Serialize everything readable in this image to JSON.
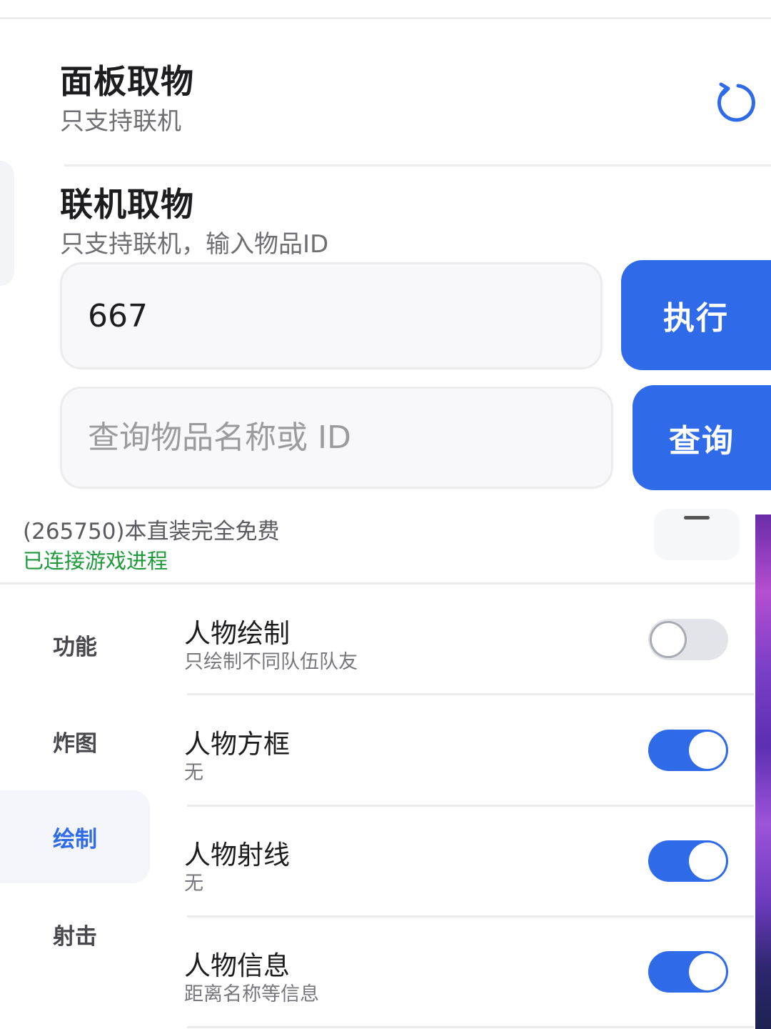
{
  "top_panel": {
    "rows": [
      {
        "title": "面板取物",
        "subtitle": "只支持联机"
      },
      {
        "title": "联机取物",
        "subtitle": "只支持联机，输入物品ID"
      }
    ],
    "item_id_input": {
      "value": "667",
      "placeholder": ""
    },
    "execute_button": "执行",
    "search_input": {
      "value": "",
      "placeholder": "查询物品名称或 ID"
    },
    "search_button": "查询",
    "refresh_icon": "refresh-icon"
  },
  "panel": {
    "info": "(265750)本直装完全免费",
    "status": "已连接游戏进程",
    "status_color": "#1e9a3b",
    "accent_color": "#2f6ae9",
    "minimize_icon": "minus-icon",
    "sidebar": [
      {
        "label": "功能",
        "active": false
      },
      {
        "label": "炸图",
        "active": false
      },
      {
        "label": "绘制",
        "active": true
      },
      {
        "label": "射击",
        "active": false
      }
    ],
    "options": [
      {
        "title": "人物绘制",
        "subtitle": "只绘制不同队伍队友",
        "enabled": false
      },
      {
        "title": "人物方框",
        "subtitle": "无",
        "enabled": true
      },
      {
        "title": "人物射线",
        "subtitle": "无",
        "enabled": true
      },
      {
        "title": "人物信息",
        "subtitle": "距离名称等信息",
        "enabled": true
      }
    ]
  }
}
